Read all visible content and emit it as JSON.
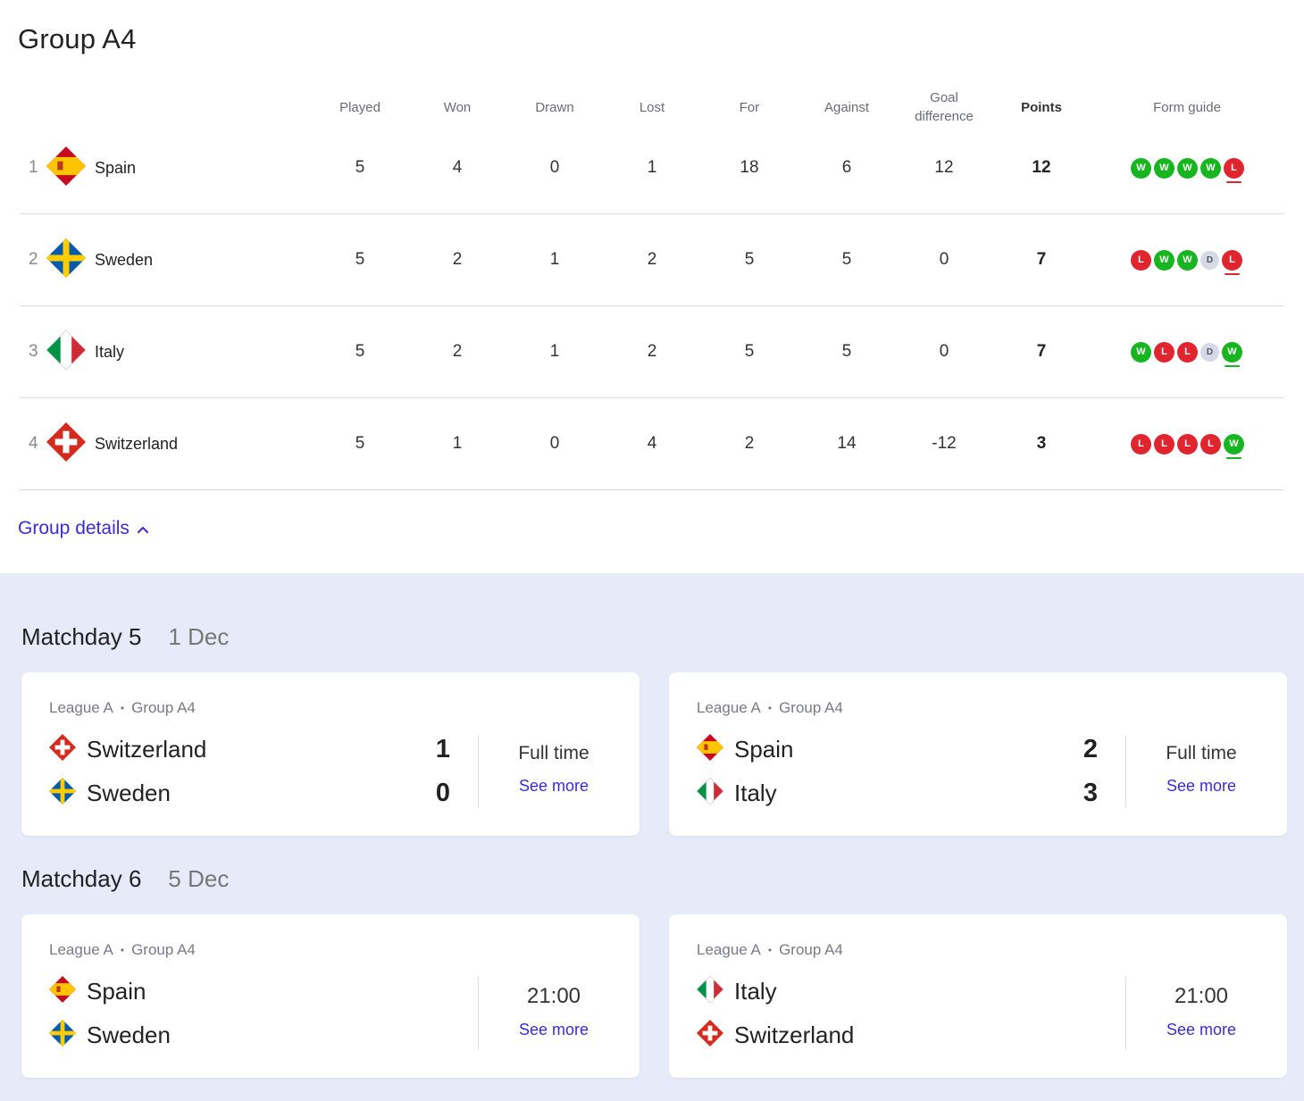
{
  "group": {
    "title": "Group A4",
    "headers": {
      "played": "Played",
      "won": "Won",
      "drawn": "Drawn",
      "lost": "Lost",
      "for": "For",
      "against": "Against",
      "goal_difference": "Goal difference",
      "points": "Points",
      "form_guide": "Form guide"
    },
    "standings": [
      {
        "pos": "1",
        "team": "Spain",
        "flag": "spain-flag-icon",
        "played": "5",
        "won": "4",
        "drawn": "0",
        "lost": "1",
        "for": "18",
        "against": "6",
        "gd": "12",
        "points": "12",
        "form": [
          "W",
          "W",
          "W",
          "W",
          "L"
        ]
      },
      {
        "pos": "2",
        "team": "Sweden",
        "flag": "sweden-flag-icon",
        "played": "5",
        "won": "2",
        "drawn": "1",
        "lost": "2",
        "for": "5",
        "against": "5",
        "gd": "0",
        "points": "7",
        "form": [
          "L",
          "W",
          "W",
          "D",
          "L"
        ]
      },
      {
        "pos": "3",
        "team": "Italy",
        "flag": "italy-flag-icon",
        "played": "5",
        "won": "2",
        "drawn": "1",
        "lost": "2",
        "for": "5",
        "against": "5",
        "gd": "0",
        "points": "7",
        "form": [
          "W",
          "L",
          "L",
          "D",
          "W"
        ]
      },
      {
        "pos": "4",
        "team": "Switzerland",
        "flag": "switzerland-flag-icon",
        "played": "5",
        "won": "1",
        "drawn": "0",
        "lost": "4",
        "for": "2",
        "against": "14",
        "gd": "-12",
        "points": "3",
        "form": [
          "L",
          "L",
          "L",
          "L",
          "W"
        ]
      }
    ],
    "details_link": "Group details"
  },
  "matchdays": [
    {
      "title": "Matchday 5",
      "date": "1 Dec",
      "matches": [
        {
          "league": "League A",
          "group": "Group A4",
          "home": "Switzerland",
          "away": "Sweden",
          "home_score": "1",
          "away_score": "0",
          "status": "Full time",
          "see_more": "See more"
        },
        {
          "league": "League A",
          "group": "Group A4",
          "home": "Spain",
          "away": "Italy",
          "home_score": "2",
          "away_score": "3",
          "status": "Full time",
          "see_more": "See more"
        }
      ]
    },
    {
      "title": "Matchday 6",
      "date": "5 Dec",
      "matches": [
        {
          "league": "League A",
          "group": "Group A4",
          "home": "Spain",
          "away": "Sweden",
          "status": "21:00",
          "see_more": "See more"
        },
        {
          "league": "League A",
          "group": "Group A4",
          "home": "Italy",
          "away": "Switzerland",
          "status": "21:00",
          "see_more": "See more"
        }
      ]
    }
  ],
  "colors": {
    "win": "#17b51f",
    "loss": "#e0252f",
    "draw": "#d6dae8",
    "link": "#3a2bd8",
    "panel_background": "#e6eaf9"
  }
}
